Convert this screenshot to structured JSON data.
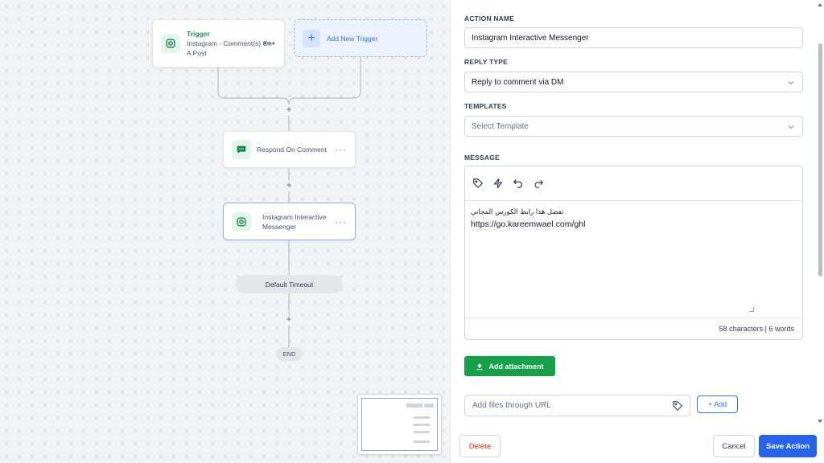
{
  "workflow": {
    "trigger": {
      "title": "Trigger",
      "line1": "Instagram - Comment(s) On",
      "line2": "A Post",
      "menu": "•••"
    },
    "add_trigger_label": "Add New Trigger",
    "respond_node": {
      "label": "Respond On Comment",
      "menu": "···"
    },
    "ig_node": {
      "line1": "Instagram Interactive",
      "line2": "Messenger",
      "menu": "···"
    },
    "timeout_label": "Default Timeout",
    "end_label": "END",
    "plus": "+"
  },
  "panel": {
    "action_name_label": "ACTION NAME",
    "action_name_value": "Instagram Interactive Messenger",
    "reply_type_label": "REPLY TYPE",
    "reply_type_value": "Reply to comment via DM",
    "templates_label": "TEMPLATES",
    "templates_placeholder": "Select Template",
    "message_label": "MESSAGE",
    "message_line1": "تفضل هذا رابط الكورس المجاني",
    "message_line2": "https://go.kareemwael.com/ghl",
    "message_counter": "58 characters | 6 words",
    "add_attachment_label": "Add attachment",
    "url_placeholder": "Add files through URL",
    "add_button_label": "+ Add",
    "delete_label": "Delete",
    "cancel_label": "Cancel",
    "save_label": "Save Action"
  },
  "colors": {
    "accent_green": "#15a04a",
    "accent_blue": "#2563eb",
    "trigger_green": "#17964b",
    "delete_red": "#d92d20"
  }
}
